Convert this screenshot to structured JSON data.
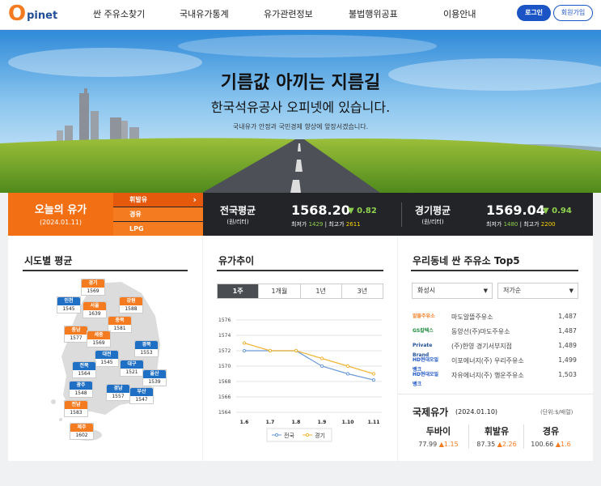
{
  "header": {
    "logo_o": "O",
    "logo_text": "pinet",
    "nav": [
      "싼 주유소찾기",
      "국내유가통계",
      "유가관련정보",
      "불법행위공표",
      "이용안내"
    ],
    "login": "로그인",
    "join": "회원가입"
  },
  "hero": {
    "title": "기름값 아끼는 지름길",
    "subtitle": "한국석유공사 오피넷에 있습니다.",
    "desc": "국내유가 안정과 국민경제 향상에 앞장서겠습니다."
  },
  "today": {
    "title": "오늘의 유가",
    "date": "(2024.01.11)",
    "fuel_tabs": [
      "휘발유",
      "경유",
      "LPG"
    ],
    "arrow": "›"
  },
  "national": {
    "label": "전국평균",
    "unit": "(원/리터)",
    "value": "1568.20",
    "change": "▼ 0.82",
    "min_label": "최저가",
    "min": "1429",
    "max_label": "최고가",
    "max": "2611",
    "sep": "|"
  },
  "gyeonggi": {
    "label": "경기평균",
    "unit": "(원/리터)",
    "value": "1569.04",
    "change": "▼ 0.94",
    "min_label": "최저가",
    "min": "1480",
    "max_label": "최고가",
    "max": "2200",
    "sep": "|"
  },
  "regions": {
    "title": "시도별 평균",
    "items": [
      {
        "name": "경기",
        "value": "1569",
        "color": "orange"
      },
      {
        "name": "인천",
        "value": "1545",
        "color": "blue"
      },
      {
        "name": "서울",
        "value": "1639",
        "color": "orange"
      },
      {
        "name": "강원",
        "value": "1588",
        "color": "orange"
      },
      {
        "name": "충북",
        "value": "1581",
        "color": "orange"
      },
      {
        "name": "충남",
        "value": "1577",
        "color": "orange"
      },
      {
        "name": "세종",
        "value": "1569",
        "color": "orange"
      },
      {
        "name": "대전",
        "value": "1545",
        "color": "blue"
      },
      {
        "name": "경북",
        "value": "1553",
        "color": "blue"
      },
      {
        "name": "전북",
        "value": "1564",
        "color": "blue"
      },
      {
        "name": "대구",
        "value": "1521",
        "color": "blue"
      },
      {
        "name": "울산",
        "value": "1539",
        "color": "blue"
      },
      {
        "name": "광주",
        "value": "1548",
        "color": "blue"
      },
      {
        "name": "경남",
        "value": "1557",
        "color": "blue"
      },
      {
        "name": "부산",
        "value": "1547",
        "color": "blue"
      },
      {
        "name": "전남",
        "value": "1583",
        "color": "orange"
      },
      {
        "name": "제주",
        "value": "1602",
        "color": "orange"
      }
    ]
  },
  "trend": {
    "title": "유가추이",
    "tabs": [
      "1주",
      "1개월",
      "1년",
      "3년"
    ],
    "selected_tab": "1주"
  },
  "chart_data": {
    "type": "line",
    "x": [
      "1.6",
      "1.7",
      "1.8",
      "1.9",
      "1.10",
      "1.11"
    ],
    "y_ticks": [
      "1576",
      "1574",
      "1572",
      "1570",
      "1568",
      "1566",
      "1564"
    ],
    "ylim": [
      1564,
      1576
    ],
    "grid": true,
    "legend_position": "bottom",
    "series": [
      {
        "name": "전국",
        "color": "#6a9ad8",
        "values": [
          1572.0,
          1572.0,
          1572.0,
          1570.0,
          1569.0,
          1568.2
        ]
      },
      {
        "name": "경기",
        "color": "#f2b536",
        "values": [
          1573.0,
          1572.0,
          1572.0,
          1571.0,
          1570.0,
          1569.0
        ]
      }
    ]
  },
  "top5": {
    "title": "우리동네 싼 주유소 Top5",
    "region_select": "화성시",
    "sort_select": "저가순",
    "stations": [
      {
        "brand": "알뜰주유소",
        "name": "마도알뜰주유소",
        "price": "1,487",
        "brand_color": "#f47b20"
      },
      {
        "brand": "GS칼텍스",
        "name": "동양선(주)마도주유소",
        "price": "1,487",
        "brand_color": "#1b8a3a"
      },
      {
        "brand": "Private Brand",
        "name": "(주)한영 경기서부지점",
        "price": "1,489",
        "brand_color": "#1f4e96"
      },
      {
        "brand": "HD현대오일뱅크",
        "name": "이포에너지(주) 우리주유소",
        "price": "1,499",
        "brand_color": "#1b55c5"
      },
      {
        "brand": "HD현대오일뱅크",
        "name": "자유에너지(주) 행운주유소",
        "price": "1,503",
        "brand_color": "#1b55c5"
      }
    ]
  },
  "intl": {
    "title": "국제유가",
    "date": "(2024.01.10)",
    "unit": "(단위:$/배럴)",
    "items": [
      {
        "name": "두바이",
        "value": "77.99",
        "change": "▲1.15"
      },
      {
        "name": "휘발유",
        "value": "87.35",
        "change": "▲2.26"
      },
      {
        "name": "경유",
        "value": "100.66",
        "change": "▲1.6"
      }
    ]
  }
}
